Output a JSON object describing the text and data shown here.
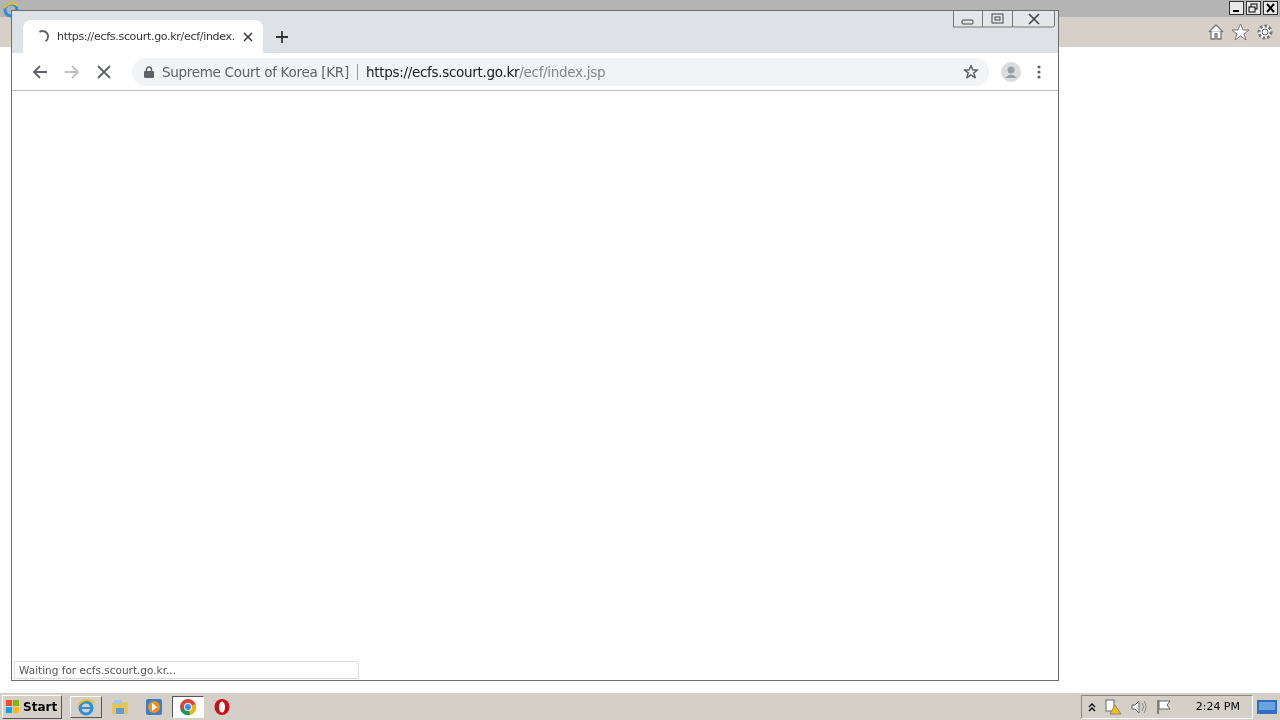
{
  "browser": {
    "tabs": [
      {
        "title": "https://ecfs.scourt.go.kr/ecf/index.",
        "selected": true,
        "loading": true
      }
    ],
    "forward_disabled": true,
    "omnibox": {
      "site_identity": "Supreme Court of Korea [KR]",
      "url_host": "https://ecfs.scourt.go.kr",
      "url_path": "/ecf/index.jsp"
    },
    "status": "Waiting for ecfs.scourt.go.kr..."
  },
  "taskbar": {
    "start": "Start",
    "apps": [
      {
        "kind": "ie",
        "selected": false
      },
      {
        "kind": "folder",
        "selected": false
      },
      {
        "kind": "media",
        "selected": false
      },
      {
        "kind": "chrome",
        "selected": true
      },
      {
        "kind": "opera",
        "selected": false
      }
    ],
    "clock": "2:24 PM"
  }
}
